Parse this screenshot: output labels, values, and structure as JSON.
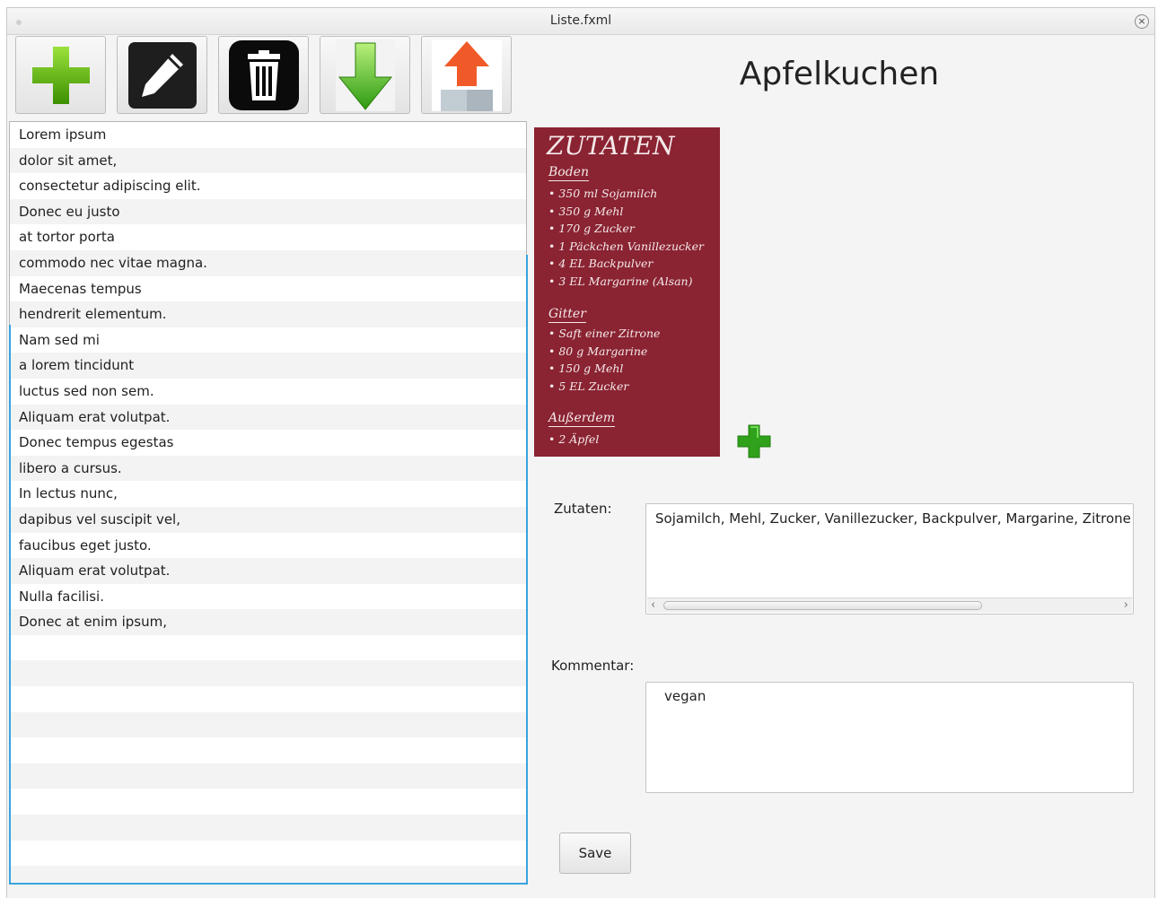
{
  "window": {
    "title": "Liste.fxml",
    "close_glyph": "×"
  },
  "toolbar": {
    "buttons": [
      {
        "name": "add",
        "icon": "plus-icon"
      },
      {
        "name": "edit",
        "icon": "pencil-icon"
      },
      {
        "name": "delete",
        "icon": "trash-icon"
      },
      {
        "name": "import",
        "icon": "arrow-down-icon"
      },
      {
        "name": "export",
        "icon": "upload-icon"
      }
    ]
  },
  "list": {
    "items": [
      "Lorem ipsum",
      "dolor sit amet,",
      "consectetur adipiscing elit.",
      "Donec eu justo",
      "at tortor porta",
      "commodo nec vitae magna.",
      "Maecenas tempus",
      "hendrerit elementum.",
      "Nam sed mi",
      "a lorem tincidunt",
      "luctus sed non sem.",
      "Aliquam erat volutpat.",
      "Donec tempus egestas",
      "libero a cursus.",
      "In lectus nunc,",
      "dapibus vel suscipit vel,",
      "faucibus eget justo.",
      "Aliquam erat volutpat.",
      "Nulla facilisi.",
      "Donec at enim ipsum,"
    ]
  },
  "detail": {
    "title": "Apfelkuchen",
    "recipe_image": {
      "heading": "ZUTATEN",
      "sections": [
        {
          "title": "Boden",
          "items": [
            "• 350 ml Sojamilch",
            "• 350 g Mehl",
            "• 170 g Zucker",
            "• 1 Päckchen Vanillezucker",
            "• 4 EL Backpulver",
            "• 3 EL Margarine (Alsan)"
          ]
        },
        {
          "title": "Gitter",
          "items": [
            "• Saft einer Zitrone",
            "• 80 g Margarine",
            "• 150 g Mehl",
            "• 5 EL Zucker"
          ]
        },
        {
          "title": "Außerdem",
          "items": [
            "• 2 Äpfel"
          ]
        }
      ]
    },
    "zutaten_label": "Zutaten:",
    "zutaten_value": "Sojamilch, Mehl, Zucker, Vanillezucker, Backpulver,  Margarine, Zitrone",
    "kommentar_label": "Kommentar:",
    "kommentar_value": "vegan",
    "save_label": "Save"
  },
  "colors": {
    "accent_focus": "#39a3dd",
    "recipe_card_bg": "#8a2332",
    "plus_green": "#3f9e00"
  }
}
